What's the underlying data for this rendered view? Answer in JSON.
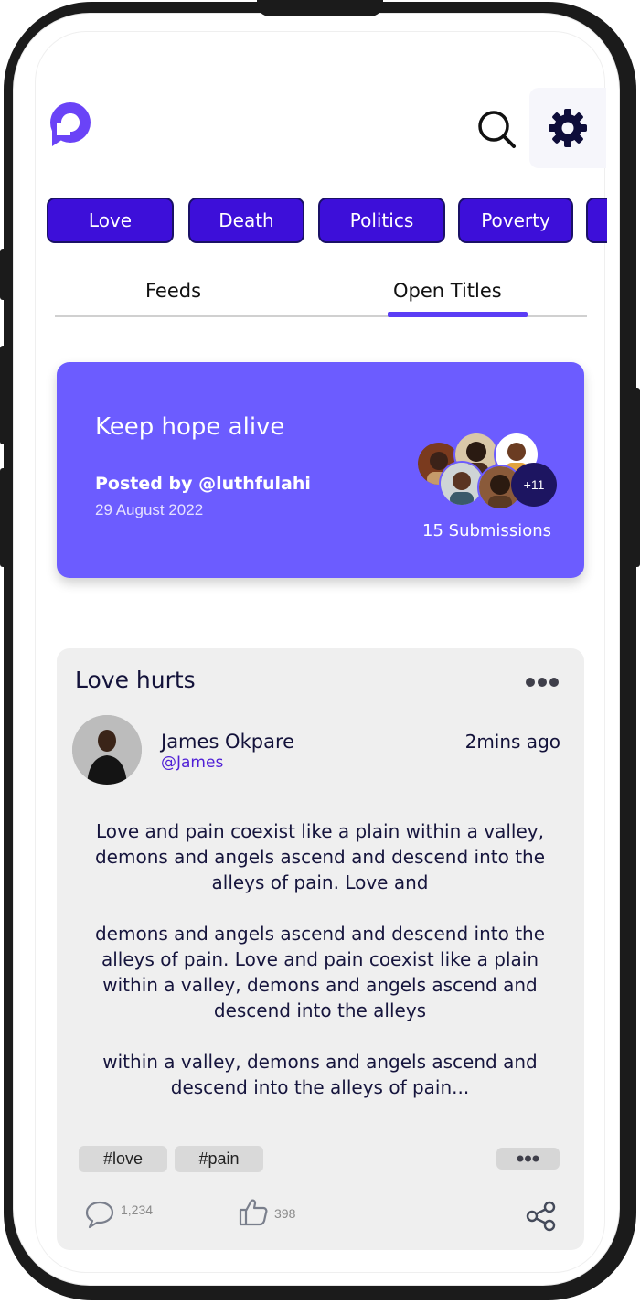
{
  "app": {
    "brand_color": "#5b3df5",
    "logo_icon": "p-logo-icon"
  },
  "header": {
    "search_icon": "search-icon",
    "settings_icon": "gear-icon"
  },
  "categories": [
    "Love",
    "Death",
    "Politics",
    "Poverty"
  ],
  "tabs": [
    {
      "label": "Feeds",
      "active": false
    },
    {
      "label": "Open Titles",
      "active": true
    }
  ],
  "featured": {
    "title": "Keep hope alive",
    "posted_by": "Posted by @luthfulahi",
    "date": "29 August 2022",
    "more_count": "+11",
    "submissions": "15 Submissions",
    "background": "#6c5cff"
  },
  "post": {
    "title": "Love hurts",
    "author_name": "James Okpare",
    "author_handle": "@James",
    "time": "2mins ago",
    "body": [
      "Love and pain coexist like a plain within a valley, demons and angels ascend and descend into the alleys of pain. Love and",
      "demons and angels ascend and descend into the alleys of pain. Love and pain coexist like a plain within a valley, demons and angels ascend and descend into the alleys",
      "within a valley, demons and angels ascend and descend into the alleys of pain..."
    ],
    "tags": [
      "#love",
      "#pain"
    ],
    "comments": "1,234",
    "likes": "398"
  }
}
